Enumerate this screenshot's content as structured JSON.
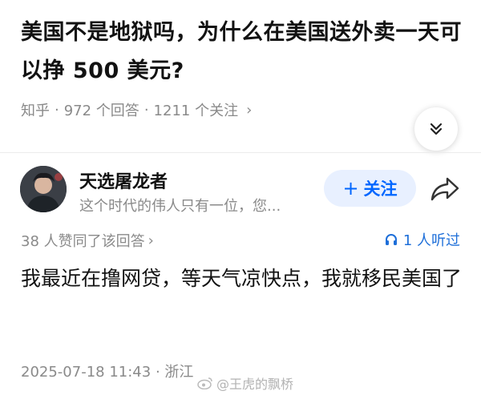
{
  "question": {
    "title": "美国不是地狱吗，为什么在美国送外卖一天可以挣 500 美元?",
    "source": "知乎",
    "answers_count": "972 个回答",
    "followers_count": "1211 个关注",
    "sep": "·"
  },
  "author": {
    "name": "天选屠龙者",
    "bio": "这个时代的伟人只有一位，您...",
    "follow_label": "关注"
  },
  "answer": {
    "likes_text": "38 人赞同了该回答",
    "listeners_text": "1 人听过",
    "body": "我最近在撸网贷，等天气凉快点，我就移民美国了",
    "date": "2025-07-18 11:43",
    "location": "浙江"
  },
  "watermark": {
    "text": "@王虎的飘桥"
  },
  "colors": {
    "accent": "#0066ff",
    "follow_bg": "#e8f0ff",
    "muted": "#8a8a8a"
  }
}
